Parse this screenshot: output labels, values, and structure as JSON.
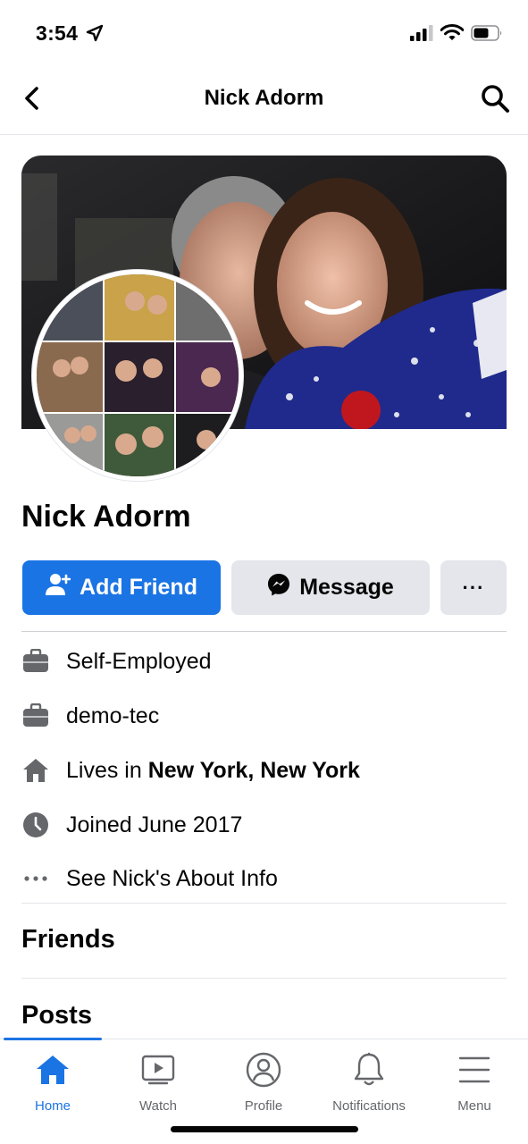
{
  "status_bar": {
    "time": "3:54",
    "icons": [
      "location-arrow-icon",
      "cellular-signal-icon",
      "wifi-icon",
      "battery-icon"
    ]
  },
  "header": {
    "title": "Nick Adorm",
    "back_icon": "chevron-left-icon",
    "search_icon": "search-icon"
  },
  "profile": {
    "name": "Nick Adorm"
  },
  "actions": {
    "add_friend_label": "Add Friend",
    "message_label": "Message",
    "more_label": "···"
  },
  "intro": [
    {
      "icon": "briefcase-icon",
      "prefix": "Self-Employed",
      "bold": ""
    },
    {
      "icon": "briefcase-icon",
      "prefix": "demo-tec",
      "bold": ""
    },
    {
      "icon": "house-icon",
      "prefix": "Lives in ",
      "bold": "New York, New York"
    },
    {
      "icon": "clock-icon",
      "prefix": "Joined June 2017",
      "bold": ""
    },
    {
      "icon": "more-dots-icon",
      "prefix": "See Nick's About Info",
      "bold": ""
    }
  ],
  "sections": {
    "friends": "Friends",
    "posts": "Posts"
  },
  "tabbar": {
    "active": "home",
    "tabs": [
      {
        "id": "home",
        "label": "Home",
        "icon": "home-icon"
      },
      {
        "id": "watch",
        "label": "Watch",
        "icon": "watch-icon"
      },
      {
        "id": "profile",
        "label": "Profile",
        "icon": "profile-icon"
      },
      {
        "id": "notifications",
        "label": "Notifications",
        "icon": "bell-icon"
      },
      {
        "id": "menu",
        "label": "Menu",
        "icon": "menu-icon"
      }
    ]
  },
  "colors": {
    "accent": "#1b74e4",
    "button_gray": "#e4e6eb",
    "icon_gray": "#65676b"
  }
}
